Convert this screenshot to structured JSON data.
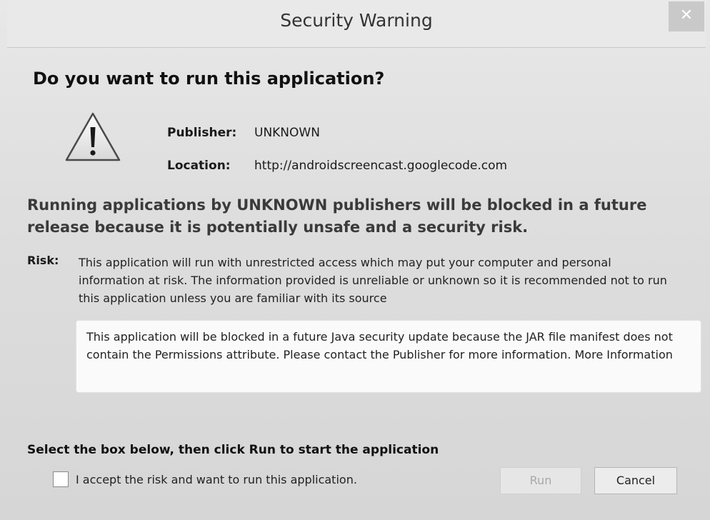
{
  "window": {
    "title": "Security Warning",
    "close_glyph": "✕"
  },
  "heading": "Do you want to run this application?",
  "icon": "warning-icon",
  "publisher": {
    "label": "Publisher:",
    "value": "UNKNOWN"
  },
  "location": {
    "label": "Location:",
    "value": "http://androidscreencast.googlecode.com"
  },
  "notice": "Running applications by UNKNOWN publishers will be blocked in a future release because it is potentially unsafe and a security risk.",
  "risk": {
    "label": "Risk:",
    "text": "This application will run with unrestricted access which may put your computer and personal information at risk. The information provided is unreliable or unknown so it is recommended not to run this application unless you are familiar with its source"
  },
  "info_box": {
    "text": "This application will be blocked in a future Java security update because the JAR file manifest does not contain the Permissions attribute. Please contact the Publisher for more information.",
    "link": "More Information"
  },
  "instructions": "Select the box below, then click Run to start the application",
  "accept": {
    "label": "I accept the risk and want to run this application.",
    "checked": false
  },
  "buttons": {
    "run": "Run",
    "cancel": "Cancel"
  }
}
